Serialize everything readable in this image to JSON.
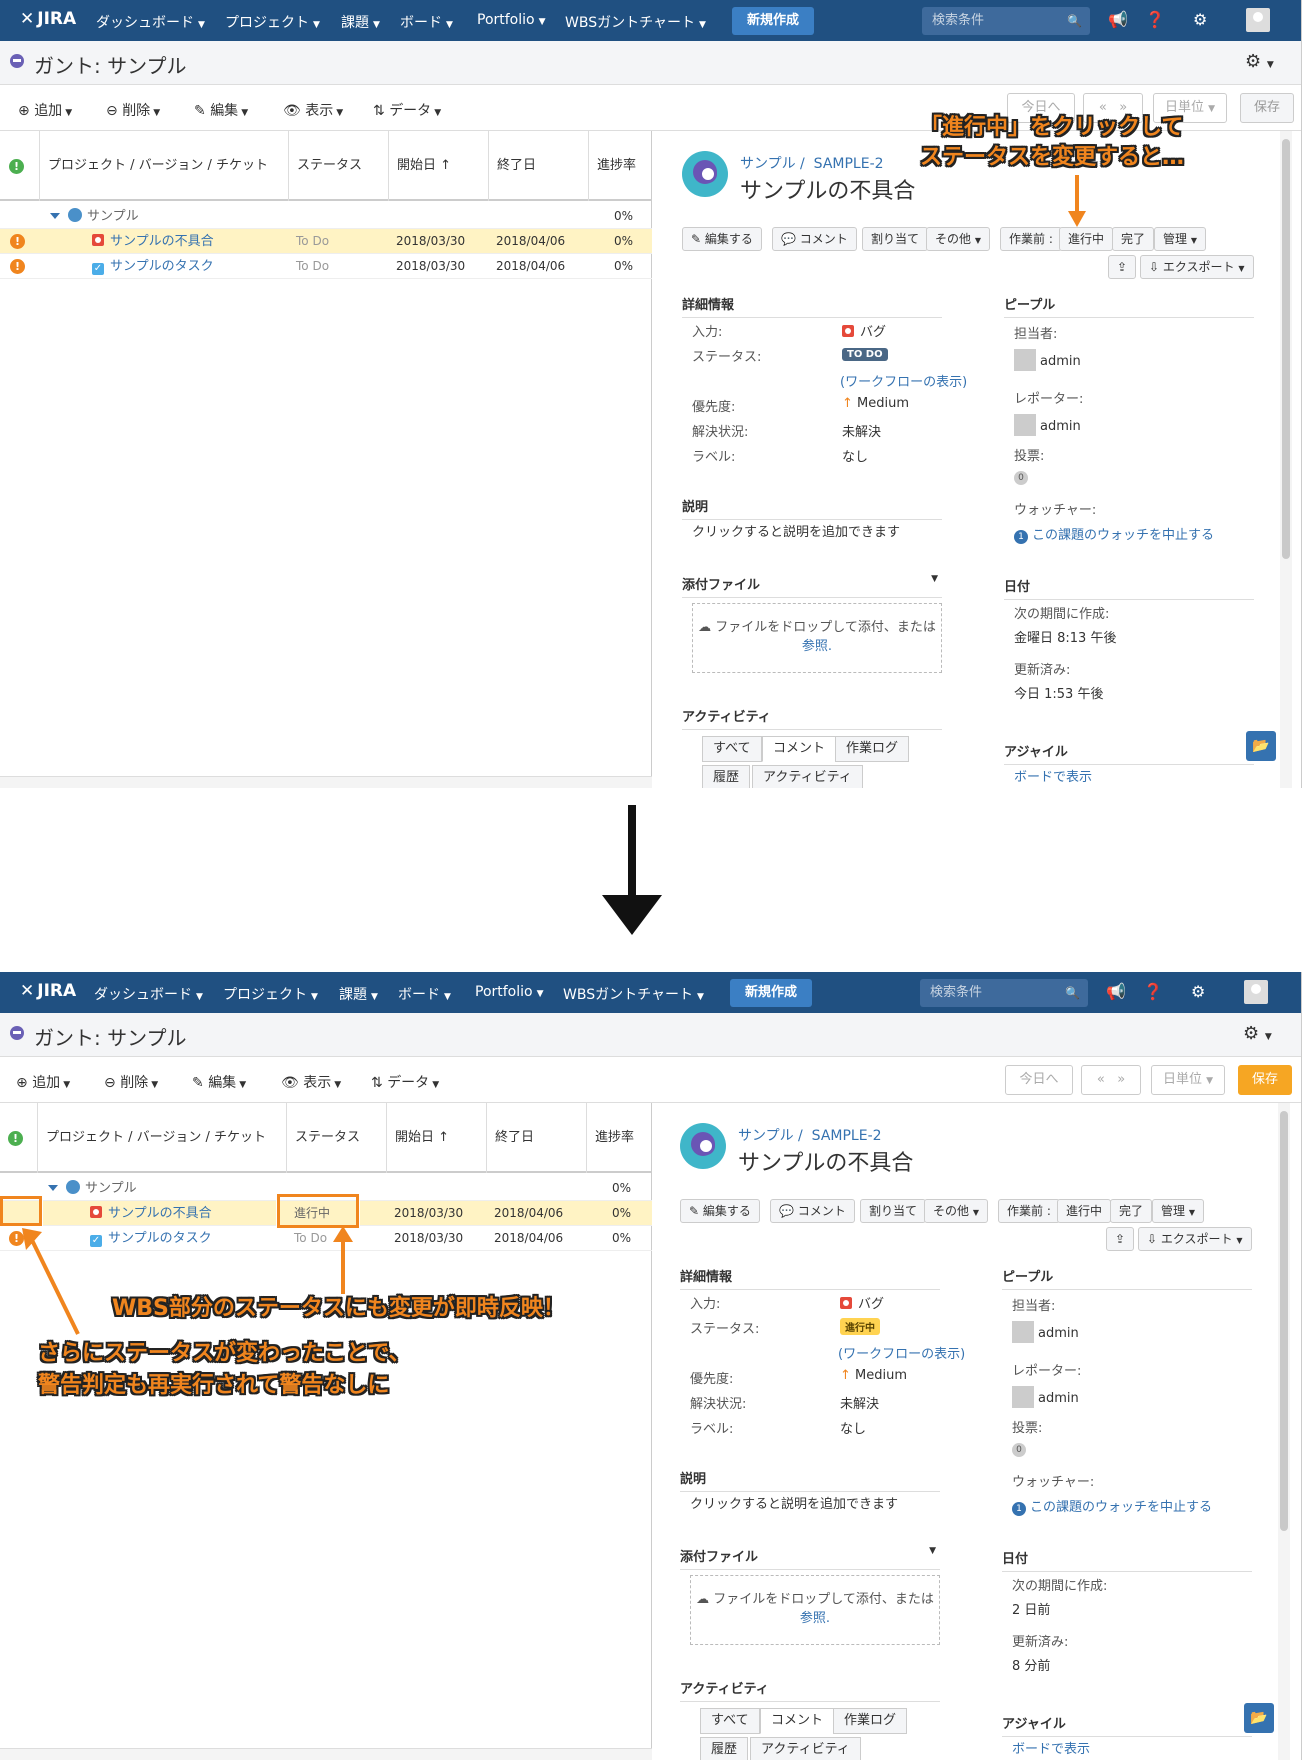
{
  "nav": {
    "logo": "JIRA",
    "menus": [
      "ダッシュボード",
      "プロジェクト",
      "課題",
      "ボード",
      "Portfolio",
      "WBSガントチャート"
    ],
    "create": "新規作成",
    "search_placeholder": "検索条件"
  },
  "page": {
    "title": "ガント: サンプル"
  },
  "toolbar": {
    "add": "追加",
    "delete": "削除",
    "edit": "編集",
    "view": "表示",
    "data": "データ",
    "today": "今日へ",
    "prev": "«",
    "next": "»",
    "unit": "日単位",
    "save": "保存"
  },
  "grid": {
    "headers": [
      "プロジェクト / バージョン / チケット",
      "ステータス",
      "開始日 ↑",
      "終了日",
      "進捗率"
    ],
    "project": {
      "name": "サンプル",
      "progress": "0%"
    },
    "rows": [
      {
        "name": "サンプルの不具合",
        "status": "To Do",
        "start": "2018/03/30",
        "end": "2018/04/06",
        "progress": "0%"
      },
      {
        "name": "サンプルのタスク",
        "status": "To Do",
        "start": "2018/03/30",
        "end": "2018/04/06",
        "progress": "0%"
      }
    ],
    "updated_status": "進行中"
  },
  "issue": {
    "project": "サンプル",
    "key": "SAMPLE-2",
    "title": "サンプルの不具合",
    "buttons": {
      "edit": "編集する",
      "comment": "コメント",
      "assign": "割り当て",
      "more": "その他",
      "before": "作業前",
      "in_progress": "進行中",
      "done": "完了",
      "admin": "管理",
      "export": "エクスポート"
    },
    "details": {
      "heading": "詳細情報",
      "type_label": "入力:",
      "type_value": "バグ",
      "status_label": "ステータス:",
      "status_todo": "TO DO",
      "status_prog": "進行中",
      "workflow": "(ワークフローの表示)",
      "priority_label": "優先度:",
      "priority_value": "Medium",
      "resolution_label": "解決状況:",
      "resolution_value": "未解決",
      "labels_label": "ラベル:",
      "labels_value": "なし"
    },
    "people": {
      "heading": "ピープル",
      "assignee_label": "担当者:",
      "assignee": "admin",
      "reporter_label": "レポーター:",
      "reporter": "admin",
      "votes_label": "投票:",
      "votes": "0",
      "watchers_label": "ウォッチャー:",
      "watchers_count": "1",
      "watch_link": "この課題のウォッチを中止する"
    },
    "description": {
      "heading": "説明",
      "text": "クリックすると説明を追加できます"
    },
    "attachments": {
      "heading": "添付ファイル",
      "drop": "ファイルをドロップして添付、または",
      "browse": "参照."
    },
    "dates": {
      "heading": "日付",
      "created_label": "次の期間に作成:",
      "created_top": "金曜日 8:13 午後",
      "created_bottom": "2 日前",
      "updated_label": "更新済み:",
      "updated_top": "今日 1:53 午後",
      "updated_bottom": "8 分前"
    },
    "activity": {
      "heading": "アクティビティ",
      "tabs": [
        "すべて",
        "コメント",
        "作業ログ"
      ],
      "tabs2": [
        "履歴",
        "アクティビティ"
      ]
    },
    "agile": {
      "heading": "アジャイル",
      "link": "ボードで表示"
    }
  },
  "annotations": {
    "top_line1": "「進行中」をクリックして",
    "top_line2": "ステータスを変更すると…",
    "bottom_main": "WBS部分のステータスにも変更が即時反映！",
    "bottom_sub1": "さらにステータスが変わったことで、",
    "bottom_sub2": "警告判定も再実行されて警告なしに"
  }
}
